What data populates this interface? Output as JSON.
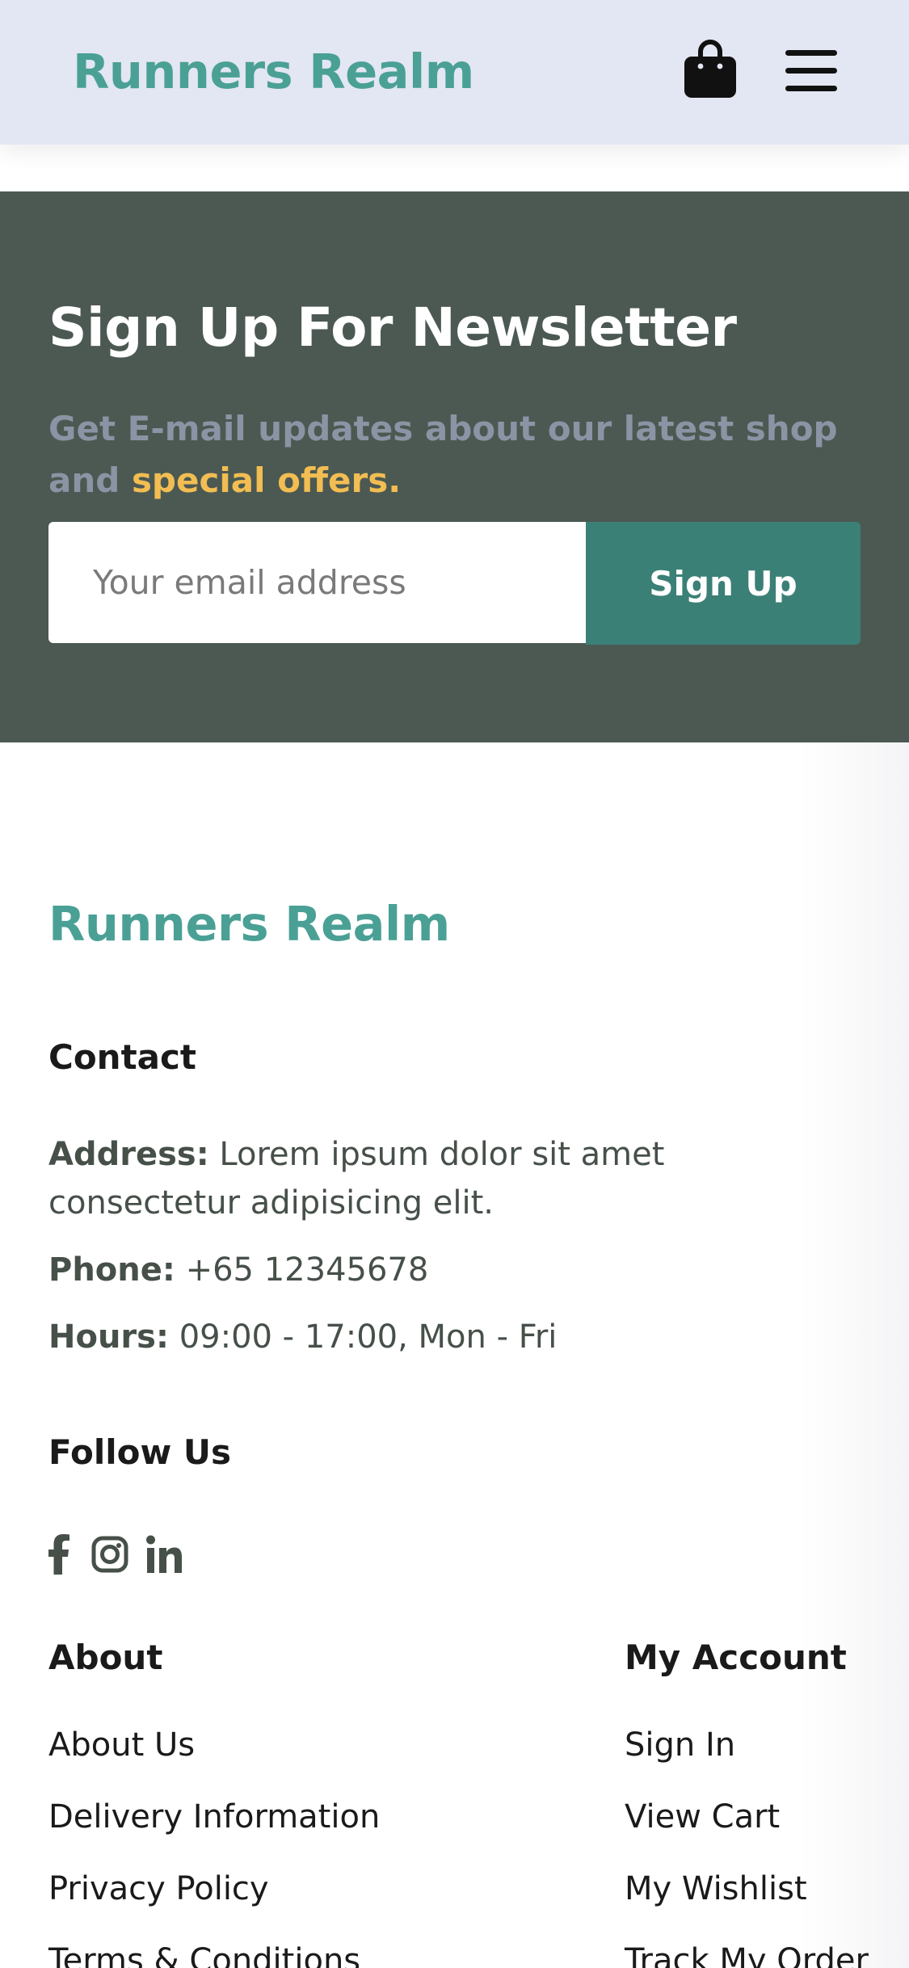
{
  "header": {
    "logo": "Runners Realm",
    "icons": {
      "bag": "shopping-bag-icon",
      "menu": "hamburger-menu-icon"
    }
  },
  "newsletter": {
    "title": "Sign Up For Newsletter",
    "text": "Get E-mail updates about our latest shop and",
    "text_highlight": "special offers.",
    "email_placeholder": "Your email address",
    "email_value": "",
    "button_label": "Sign Up"
  },
  "footer": {
    "logo": "Runners Realm",
    "contact": {
      "heading": "Contact",
      "address_label": "Address:",
      "address_value": "Lorem ipsum dolor sit amet consectetur adipisicing elit.",
      "phone_label": "Phone:",
      "phone_value": "+65 12345678",
      "hours_label": "Hours:",
      "hours_value": "09:00 - 17:00, Mon - Fri"
    },
    "follow": {
      "heading": "Follow Us",
      "icons": [
        "facebook-icon",
        "instagram-icon",
        "linkedin-icon"
      ]
    },
    "about": {
      "heading": "About",
      "links": [
        "About Us",
        "Delivery Information",
        "Privacy Policy",
        "Terms & Conditions"
      ]
    },
    "account": {
      "heading": "My Account",
      "links": [
        "Sign In",
        "View Cart",
        "My Wishlist",
        "Track My Order"
      ]
    }
  },
  "colors": {
    "header_bg": "#e3e6f3",
    "brand": "#4aa095",
    "newsletter_bg": "#4b5952",
    "accent": "#f2bd52",
    "button": "#3b8077"
  }
}
